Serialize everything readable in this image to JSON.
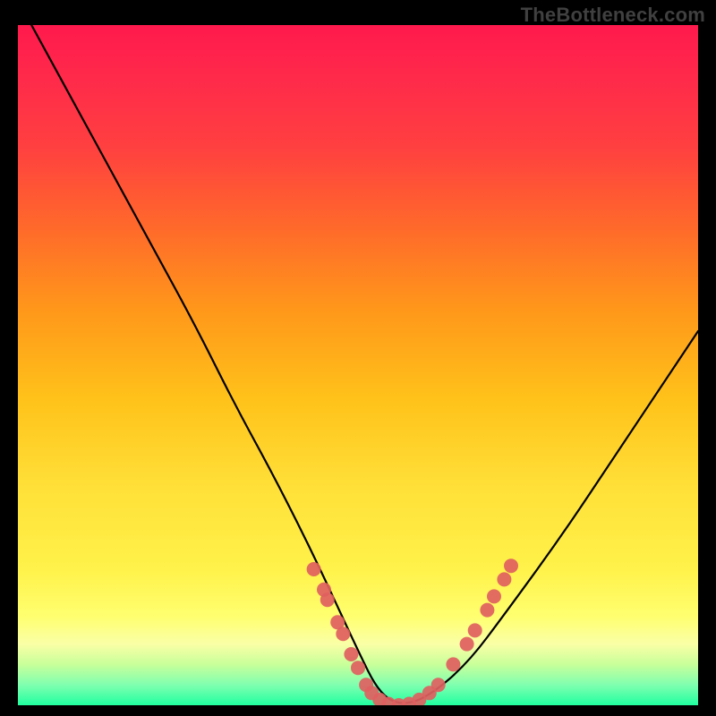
{
  "watermark": "TheBottleneck.com",
  "chart_data": {
    "type": "line",
    "title": "",
    "xlabel": "",
    "ylabel": "",
    "xlim": [
      0,
      1
    ],
    "ylim": [
      0,
      1
    ],
    "series": [
      {
        "name": "bottleneck-curve",
        "x": [
          0.02,
          0.08,
          0.14,
          0.2,
          0.26,
          0.32,
          0.38,
          0.44,
          0.5,
          0.53,
          0.56,
          0.6,
          0.66,
          0.72,
          0.8,
          0.88,
          0.96,
          1.0
        ],
        "y": [
          1.0,
          0.89,
          0.78,
          0.67,
          0.56,
          0.44,
          0.33,
          0.21,
          0.08,
          0.02,
          0.0,
          0.01,
          0.06,
          0.14,
          0.25,
          0.37,
          0.49,
          0.55
        ]
      }
    ],
    "markers": [
      {
        "x": 0.435,
        "y": 0.2
      },
      {
        "x": 0.45,
        "y": 0.17
      },
      {
        "x": 0.455,
        "y": 0.155
      },
      {
        "x": 0.47,
        "y": 0.122
      },
      {
        "x": 0.478,
        "y": 0.105
      },
      {
        "x": 0.49,
        "y": 0.075
      },
      {
        "x": 0.5,
        "y": 0.055
      },
      {
        "x": 0.512,
        "y": 0.03
      },
      {
        "x": 0.52,
        "y": 0.018
      },
      {
        "x": 0.532,
        "y": 0.008
      },
      {
        "x": 0.545,
        "y": 0.002
      },
      {
        "x": 0.56,
        "y": 0.0
      },
      {
        "x": 0.575,
        "y": 0.002
      },
      {
        "x": 0.59,
        "y": 0.008
      },
      {
        "x": 0.605,
        "y": 0.018
      },
      {
        "x": 0.618,
        "y": 0.03
      },
      {
        "x": 0.64,
        "y": 0.06
      },
      {
        "x": 0.66,
        "y": 0.09
      },
      {
        "x": 0.672,
        "y": 0.11
      },
      {
        "x": 0.69,
        "y": 0.14
      },
      {
        "x": 0.7,
        "y": 0.16
      },
      {
        "x": 0.715,
        "y": 0.185
      },
      {
        "x": 0.725,
        "y": 0.205
      }
    ],
    "background_gradient": {
      "top": "#ff1a4d",
      "mid": "#ffd53a",
      "bottom": "#20ffa0"
    }
  }
}
